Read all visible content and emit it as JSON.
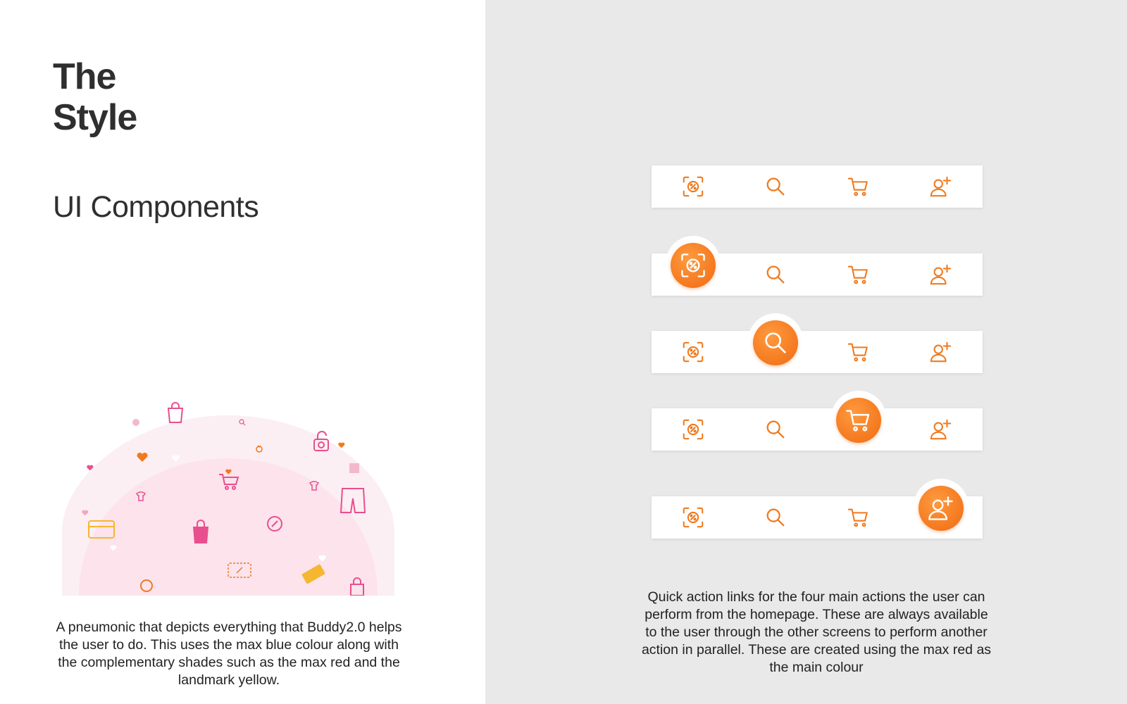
{
  "left": {
    "title_line1": "The",
    "title_line2": "Style",
    "subtitle": "UI Components",
    "caption": "A pneumonic that depicts everything that Buddy2.0 helps the user to do. This uses the max blue colour along with the complementary shades such as the max red and the landmark yellow."
  },
  "right": {
    "caption": "Quick action links for the four main actions the user can perform from the homepage. These are always available to the user through the other screens to perform another action in parallel. These are created using the max red as the main colour",
    "nav_bars": [
      {
        "active": "none"
      },
      {
        "active": "offers-scan"
      },
      {
        "active": "search"
      },
      {
        "active": "cart"
      },
      {
        "active": "add-user"
      }
    ],
    "nav_icons": [
      "offers-scan-icon",
      "search-icon",
      "cart-icon",
      "add-user-icon"
    ]
  },
  "colors": {
    "accent_orange": "#f07a1e",
    "left_background": "#ffffff",
    "right_background": "#e9e9e9",
    "illustration_pink": "#e84f8e",
    "illustration_yellow": "#f5b731"
  }
}
